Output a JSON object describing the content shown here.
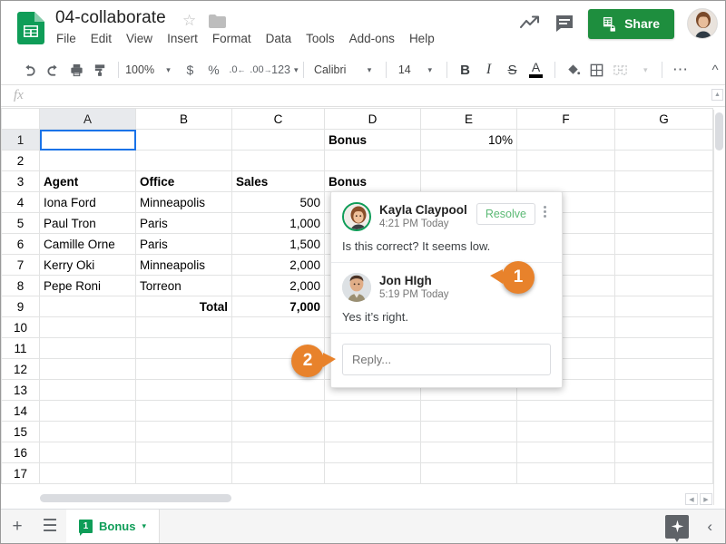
{
  "app": {
    "doc_title": "04-collaborate",
    "star_icon": "star-outline-icon",
    "folder_icon": "folder-icon"
  },
  "menubar": [
    "File",
    "Edit",
    "View",
    "Insert",
    "Format",
    "Data",
    "Tools",
    "Add-ons",
    "Help"
  ],
  "header_right": {
    "trend_icon": "activity-trend-icon",
    "comment_icon": "comment-icon",
    "share_label": "Share",
    "avatar": "user-avatar"
  },
  "toolbar": {
    "undo": "undo-icon",
    "redo": "redo-icon",
    "print": "print-icon",
    "paint": "paint-format-icon",
    "zoom": "100%",
    "currency": "$",
    "percent": "%",
    "dec_decrease": ".0",
    "dec_increase": ".00",
    "number_format": "123",
    "font": "Calibri",
    "font_size": "14",
    "bold": "B",
    "italic": "I",
    "strikethrough": "S",
    "text_color": "A",
    "fill_color": "fill-color-icon",
    "borders": "borders-icon",
    "merge": "merge-cells-icon",
    "more": "more-options-icon",
    "collapse": "collapse-toolbar-icon"
  },
  "formula_bar": {
    "fx_label": "fx",
    "value": "",
    "placeholder": ""
  },
  "grid": {
    "columns": [
      "A",
      "B",
      "C",
      "D",
      "E",
      "F",
      "G"
    ],
    "selected_cell": "A1",
    "rows": [
      {
        "num": "1",
        "a": "",
        "b": "",
        "c": "",
        "d": "Bonus",
        "e": "10%",
        "f": "",
        "g": ""
      },
      {
        "num": "2",
        "a": "",
        "b": "",
        "c": "",
        "d": "",
        "e": "",
        "f": "",
        "g": ""
      },
      {
        "num": "3",
        "a": "Agent",
        "b": "Office",
        "c": "Sales",
        "d": "Bonus",
        "e": "",
        "f": "",
        "g": ""
      },
      {
        "num": "4",
        "a": "Iona Ford",
        "b": "Minneapolis",
        "c": "500",
        "d": "",
        "e": "",
        "f": "",
        "g": ""
      },
      {
        "num": "5",
        "a": "Paul Tron",
        "b": "Paris",
        "c": "1,000",
        "d": "",
        "e": "",
        "f": "",
        "g": ""
      },
      {
        "num": "6",
        "a": "Camille Orne",
        "b": "Paris",
        "c": "1,500",
        "d": "",
        "e": "",
        "f": "",
        "g": ""
      },
      {
        "num": "7",
        "a": "Kerry Oki",
        "b": "Minneapolis",
        "c": "2,000",
        "d": "",
        "e": "",
        "f": "",
        "g": ""
      },
      {
        "num": "8",
        "a": "Pepe Roni",
        "b": "Torreon",
        "c": "2,000",
        "d": "",
        "e": "",
        "f": "",
        "g": ""
      },
      {
        "num": "9",
        "a": "",
        "b": "Total",
        "c": "7,000",
        "d": "",
        "e": "",
        "f": "",
        "g": ""
      },
      {
        "num": "10",
        "a": "",
        "b": "",
        "c": "",
        "d": "",
        "e": "",
        "f": "",
        "g": ""
      },
      {
        "num": "11",
        "a": "",
        "b": "",
        "c": "",
        "d": "",
        "e": "",
        "f": "",
        "g": ""
      },
      {
        "num": "12",
        "a": "",
        "b": "",
        "c": "",
        "d": "",
        "e": "",
        "f": "",
        "g": ""
      },
      {
        "num": "13",
        "a": "",
        "b": "",
        "c": "",
        "d": "",
        "e": "",
        "f": "",
        "g": ""
      },
      {
        "num": "14",
        "a": "",
        "b": "",
        "c": "",
        "d": "",
        "e": "",
        "f": "",
        "g": ""
      },
      {
        "num": "15",
        "a": "",
        "b": "",
        "c": "",
        "d": "",
        "e": "",
        "f": "",
        "g": ""
      },
      {
        "num": "16",
        "a": "",
        "b": "",
        "c": "",
        "d": "",
        "e": "",
        "f": "",
        "g": ""
      },
      {
        "num": "17",
        "a": "",
        "b": "",
        "c": "",
        "d": "",
        "e": "",
        "f": "",
        "g": ""
      }
    ]
  },
  "comment_popup": {
    "comments": [
      {
        "author": "Kayla Claypool",
        "time": "4:21 PM Today",
        "text": "Is this correct? It seems low.",
        "avatar": "kayla-avatar"
      },
      {
        "author": "Jon HIgh",
        "time": "5:19 PM Today",
        "text": "Yes it’s right.",
        "avatar": "jon-avatar"
      }
    ],
    "resolve_label": "Resolve",
    "kebab_icon": "more-options-icon",
    "reply_placeholder": "Reply..."
  },
  "callouts": [
    {
      "number": "1"
    },
    {
      "number": "2"
    }
  ],
  "bottom_bar": {
    "add_sheet_icon": "add-sheet-icon",
    "all_sheets_icon": "all-sheets-icon",
    "sheet_tab": {
      "badge": "1",
      "label": "Bonus",
      "caret": "▾"
    },
    "explore_icon": "explore-icon",
    "collapse_icon": "chevron-left-icon"
  },
  "colors": {
    "brand_green": "#1e8e3e",
    "accent_blue": "#1a73e8",
    "callout_orange": "#e8822b",
    "resolve_green": "#5bb974",
    "comment_flag": "#f9ab00"
  }
}
